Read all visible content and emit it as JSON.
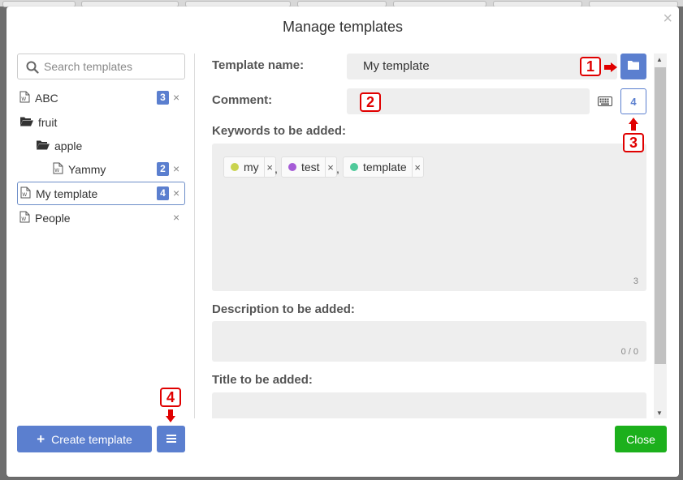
{
  "modal": {
    "title": "Manage templates",
    "close_glyph": "×"
  },
  "search": {
    "placeholder": "Search templates",
    "icon": "search-icon"
  },
  "tree": [
    {
      "label": "ABC",
      "type": "file",
      "badge": "3"
    },
    {
      "label": "fruit",
      "type": "folder"
    },
    {
      "label": "apple",
      "type": "folder"
    },
    {
      "label": "Yammy",
      "type": "file",
      "badge": "2"
    },
    {
      "label": "My template",
      "type": "file",
      "badge": "4",
      "selected": true
    },
    {
      "label": "People",
      "type": "file",
      "badge": ""
    }
  ],
  "remove_glyph": "×",
  "buttons": {
    "create": "Create template",
    "close": "Close"
  },
  "form": {
    "template_name_label": "Template name:",
    "template_name_value": "My template",
    "comment_label": "Comment:",
    "comment_count_button": "4",
    "keywords_label": "Keywords to be added:",
    "keywords": [
      {
        "text": "my",
        "color": "#c9d34e"
      },
      {
        "text": "test",
        "color": "#a55bd6"
      },
      {
        "text": "template",
        "color": "#4fc99a"
      }
    ],
    "keywords_separator": ",",
    "keywords_count": "3",
    "description_label": "Description to be added:",
    "description_count": "0 / 0",
    "title_label": "Title to be added:"
  },
  "callouts": [
    "1",
    "2",
    "3",
    "4"
  ],
  "colors": {
    "primary": "#5b7fcf",
    "success": "#1cb01c",
    "callout": "#e00000"
  }
}
